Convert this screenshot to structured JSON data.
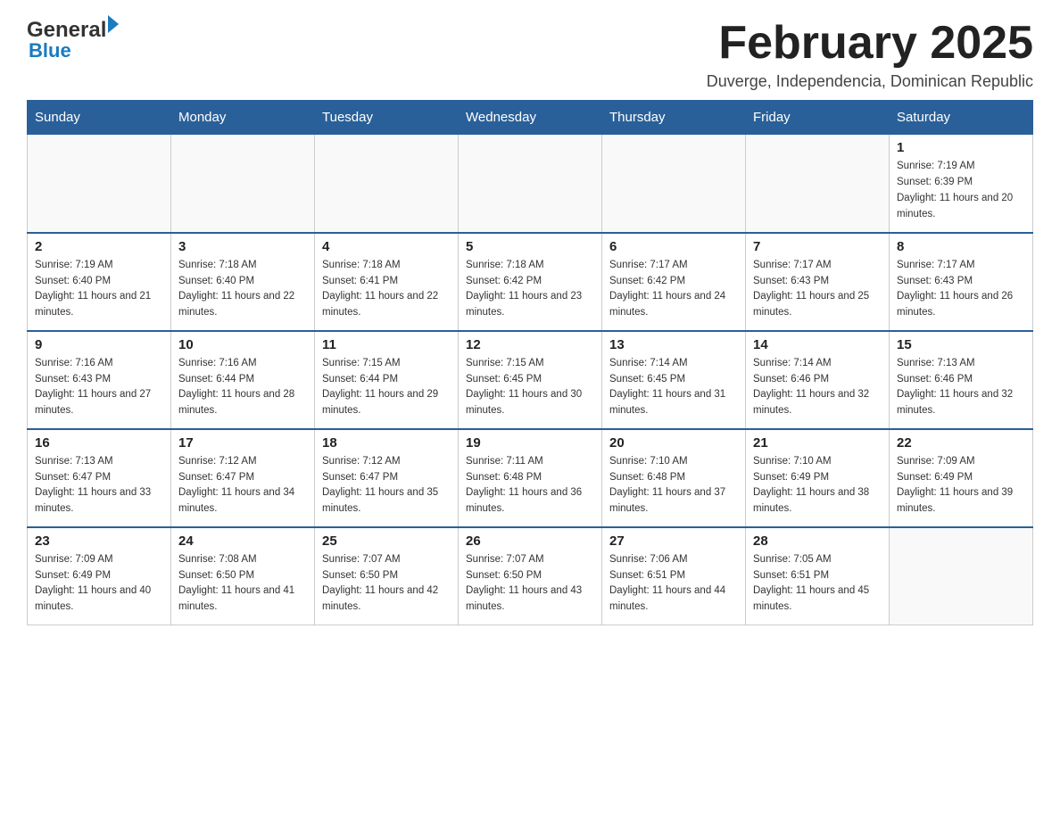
{
  "header": {
    "logo_general": "General",
    "logo_blue": "Blue",
    "month_title": "February 2025",
    "location": "Duverge, Independencia, Dominican Republic"
  },
  "days_of_week": [
    "Sunday",
    "Monday",
    "Tuesday",
    "Wednesday",
    "Thursday",
    "Friday",
    "Saturday"
  ],
  "weeks": [
    [
      {
        "day": "",
        "sunrise": "",
        "sunset": "",
        "daylight": ""
      },
      {
        "day": "",
        "sunrise": "",
        "sunset": "",
        "daylight": ""
      },
      {
        "day": "",
        "sunrise": "",
        "sunset": "",
        "daylight": ""
      },
      {
        "day": "",
        "sunrise": "",
        "sunset": "",
        "daylight": ""
      },
      {
        "day": "",
        "sunrise": "",
        "sunset": "",
        "daylight": ""
      },
      {
        "day": "",
        "sunrise": "",
        "sunset": "",
        "daylight": ""
      },
      {
        "day": "1",
        "sunrise": "Sunrise: 7:19 AM",
        "sunset": "Sunset: 6:39 PM",
        "daylight": "Daylight: 11 hours and 20 minutes."
      }
    ],
    [
      {
        "day": "2",
        "sunrise": "Sunrise: 7:19 AM",
        "sunset": "Sunset: 6:40 PM",
        "daylight": "Daylight: 11 hours and 21 minutes."
      },
      {
        "day": "3",
        "sunrise": "Sunrise: 7:18 AM",
        "sunset": "Sunset: 6:40 PM",
        "daylight": "Daylight: 11 hours and 22 minutes."
      },
      {
        "day": "4",
        "sunrise": "Sunrise: 7:18 AM",
        "sunset": "Sunset: 6:41 PM",
        "daylight": "Daylight: 11 hours and 22 minutes."
      },
      {
        "day": "5",
        "sunrise": "Sunrise: 7:18 AM",
        "sunset": "Sunset: 6:42 PM",
        "daylight": "Daylight: 11 hours and 23 minutes."
      },
      {
        "day": "6",
        "sunrise": "Sunrise: 7:17 AM",
        "sunset": "Sunset: 6:42 PM",
        "daylight": "Daylight: 11 hours and 24 minutes."
      },
      {
        "day": "7",
        "sunrise": "Sunrise: 7:17 AM",
        "sunset": "Sunset: 6:43 PM",
        "daylight": "Daylight: 11 hours and 25 minutes."
      },
      {
        "day": "8",
        "sunrise": "Sunrise: 7:17 AM",
        "sunset": "Sunset: 6:43 PM",
        "daylight": "Daylight: 11 hours and 26 minutes."
      }
    ],
    [
      {
        "day": "9",
        "sunrise": "Sunrise: 7:16 AM",
        "sunset": "Sunset: 6:43 PM",
        "daylight": "Daylight: 11 hours and 27 minutes."
      },
      {
        "day": "10",
        "sunrise": "Sunrise: 7:16 AM",
        "sunset": "Sunset: 6:44 PM",
        "daylight": "Daylight: 11 hours and 28 minutes."
      },
      {
        "day": "11",
        "sunrise": "Sunrise: 7:15 AM",
        "sunset": "Sunset: 6:44 PM",
        "daylight": "Daylight: 11 hours and 29 minutes."
      },
      {
        "day": "12",
        "sunrise": "Sunrise: 7:15 AM",
        "sunset": "Sunset: 6:45 PM",
        "daylight": "Daylight: 11 hours and 30 minutes."
      },
      {
        "day": "13",
        "sunrise": "Sunrise: 7:14 AM",
        "sunset": "Sunset: 6:45 PM",
        "daylight": "Daylight: 11 hours and 31 minutes."
      },
      {
        "day": "14",
        "sunrise": "Sunrise: 7:14 AM",
        "sunset": "Sunset: 6:46 PM",
        "daylight": "Daylight: 11 hours and 32 minutes."
      },
      {
        "day": "15",
        "sunrise": "Sunrise: 7:13 AM",
        "sunset": "Sunset: 6:46 PM",
        "daylight": "Daylight: 11 hours and 32 minutes."
      }
    ],
    [
      {
        "day": "16",
        "sunrise": "Sunrise: 7:13 AM",
        "sunset": "Sunset: 6:47 PM",
        "daylight": "Daylight: 11 hours and 33 minutes."
      },
      {
        "day": "17",
        "sunrise": "Sunrise: 7:12 AM",
        "sunset": "Sunset: 6:47 PM",
        "daylight": "Daylight: 11 hours and 34 minutes."
      },
      {
        "day": "18",
        "sunrise": "Sunrise: 7:12 AM",
        "sunset": "Sunset: 6:47 PM",
        "daylight": "Daylight: 11 hours and 35 minutes."
      },
      {
        "day": "19",
        "sunrise": "Sunrise: 7:11 AM",
        "sunset": "Sunset: 6:48 PM",
        "daylight": "Daylight: 11 hours and 36 minutes."
      },
      {
        "day": "20",
        "sunrise": "Sunrise: 7:10 AM",
        "sunset": "Sunset: 6:48 PM",
        "daylight": "Daylight: 11 hours and 37 minutes."
      },
      {
        "day": "21",
        "sunrise": "Sunrise: 7:10 AM",
        "sunset": "Sunset: 6:49 PM",
        "daylight": "Daylight: 11 hours and 38 minutes."
      },
      {
        "day": "22",
        "sunrise": "Sunrise: 7:09 AM",
        "sunset": "Sunset: 6:49 PM",
        "daylight": "Daylight: 11 hours and 39 minutes."
      }
    ],
    [
      {
        "day": "23",
        "sunrise": "Sunrise: 7:09 AM",
        "sunset": "Sunset: 6:49 PM",
        "daylight": "Daylight: 11 hours and 40 minutes."
      },
      {
        "day": "24",
        "sunrise": "Sunrise: 7:08 AM",
        "sunset": "Sunset: 6:50 PM",
        "daylight": "Daylight: 11 hours and 41 minutes."
      },
      {
        "day": "25",
        "sunrise": "Sunrise: 7:07 AM",
        "sunset": "Sunset: 6:50 PM",
        "daylight": "Daylight: 11 hours and 42 minutes."
      },
      {
        "day": "26",
        "sunrise": "Sunrise: 7:07 AM",
        "sunset": "Sunset: 6:50 PM",
        "daylight": "Daylight: 11 hours and 43 minutes."
      },
      {
        "day": "27",
        "sunrise": "Sunrise: 7:06 AM",
        "sunset": "Sunset: 6:51 PM",
        "daylight": "Daylight: 11 hours and 44 minutes."
      },
      {
        "day": "28",
        "sunrise": "Sunrise: 7:05 AM",
        "sunset": "Sunset: 6:51 PM",
        "daylight": "Daylight: 11 hours and 45 minutes."
      },
      {
        "day": "",
        "sunrise": "",
        "sunset": "",
        "daylight": ""
      }
    ]
  ]
}
